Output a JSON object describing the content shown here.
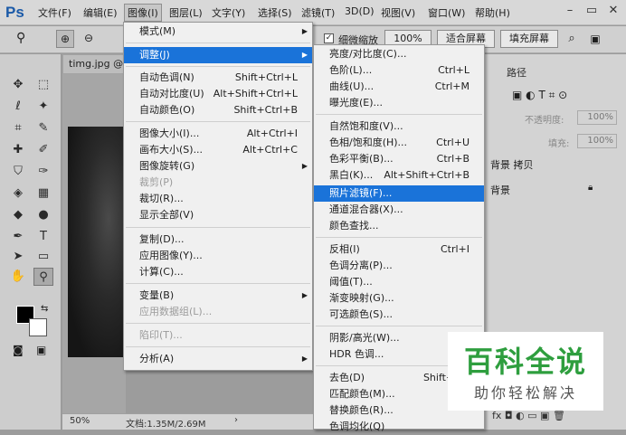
{
  "app": {
    "logo": "Ps"
  },
  "menubar": {
    "items": [
      "文件(F)",
      "编辑(E)",
      "图像(I)",
      "图层(L)",
      "文字(Y)",
      "选择(S)",
      "滤镜(T)",
      "3D(D)",
      "视图(V)",
      "窗口(W)",
      "帮助(H)"
    ],
    "active_index": 2
  },
  "optionsbar": {
    "checkbox_label": "细微缩放",
    "zoom_value": "100%",
    "fit_screen": "适合屏幕",
    "fill_screen": "填充屏幕"
  },
  "document": {
    "tab": "timg.jpg @",
    "zoom": "50%",
    "doc_info": "文档:1.35M/2.69M"
  },
  "image_menu": {
    "items": [
      {
        "label": "模式(M)",
        "shortcut": "",
        "submenu": true
      },
      {
        "label": "调整(J)",
        "shortcut": "",
        "submenu": true,
        "highlight": true
      },
      {
        "label": "自动色调(N)",
        "shortcut": "Shift+Ctrl+L"
      },
      {
        "label": "自动对比度(U)",
        "shortcut": "Alt+Shift+Ctrl+L"
      },
      {
        "label": "自动颜色(O)",
        "shortcut": "Shift+Ctrl+B"
      },
      {
        "label": "图像大小(I)...",
        "shortcut": "Alt+Ctrl+I"
      },
      {
        "label": "画布大小(S)...",
        "shortcut": "Alt+Ctrl+C"
      },
      {
        "label": "图像旋转(G)",
        "shortcut": "",
        "submenu": true
      },
      {
        "label": "裁剪(P)",
        "shortcut": "",
        "disabled": true
      },
      {
        "label": "裁切(R)...",
        "shortcut": ""
      },
      {
        "label": "显示全部(V)",
        "shortcut": ""
      },
      {
        "label": "复制(D)...",
        "shortcut": ""
      },
      {
        "label": "应用图像(Y)...",
        "shortcut": ""
      },
      {
        "label": "计算(C)...",
        "shortcut": ""
      },
      {
        "label": "变量(B)",
        "shortcut": "",
        "submenu": true
      },
      {
        "label": "应用数据组(L)...",
        "shortcut": "",
        "disabled": true
      },
      {
        "label": "陷印(T)...",
        "shortcut": "",
        "disabled": true
      },
      {
        "label": "分析(A)",
        "shortcut": "",
        "submenu": true
      }
    ]
  },
  "adjust_menu": {
    "items": [
      {
        "label": "亮度/对比度(C)...",
        "shortcut": ""
      },
      {
        "label": "色阶(L)...",
        "shortcut": "Ctrl+L"
      },
      {
        "label": "曲线(U)...",
        "shortcut": "Ctrl+M"
      },
      {
        "label": "曝光度(E)...",
        "shortcut": ""
      },
      {
        "label": "自然饱和度(V)...",
        "shortcut": ""
      },
      {
        "label": "色相/饱和度(H)...",
        "shortcut": "Ctrl+U"
      },
      {
        "label": "色彩平衡(B)...",
        "shortcut": "Ctrl+B"
      },
      {
        "label": "黑白(K)...",
        "shortcut": "Alt+Shift+Ctrl+B"
      },
      {
        "label": "照片滤镜(F)...",
        "shortcut": "",
        "highlight": true
      },
      {
        "label": "通道混合器(X)...",
        "shortcut": ""
      },
      {
        "label": "颜色查找...",
        "shortcut": ""
      },
      {
        "label": "反相(I)",
        "shortcut": "Ctrl+I"
      },
      {
        "label": "色调分离(P)...",
        "shortcut": ""
      },
      {
        "label": "阈值(T)...",
        "shortcut": ""
      },
      {
        "label": "渐变映射(G)...",
        "shortcut": ""
      },
      {
        "label": "可选颜色(S)...",
        "shortcut": ""
      },
      {
        "label": "阴影/高光(W)...",
        "shortcut": ""
      },
      {
        "label": "HDR 色调...",
        "shortcut": ""
      },
      {
        "label": "去色(D)",
        "shortcut": "Shift+Ctrl+U"
      },
      {
        "label": "匹配颜色(M)...",
        "shortcut": ""
      },
      {
        "label": "替换颜色(R)...",
        "shortcut": ""
      },
      {
        "label": "色调均化(Q)",
        "shortcut": ""
      }
    ]
  },
  "layers_panel": {
    "tab": "路径",
    "opacity_label": "不透明度:",
    "opacity_value": "100%",
    "fill_label": "填充:",
    "fill_value": "100%",
    "layers": [
      "背景 拷贝",
      "背景"
    ]
  },
  "watermark": {
    "title": "百科全说",
    "subtitle": "助你轻松解决"
  }
}
